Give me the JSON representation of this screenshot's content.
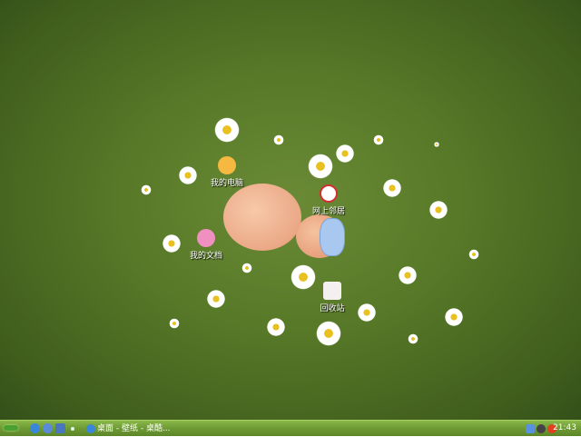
{
  "desktop": {
    "icons": [
      {
        "label": "我的电脑",
        "icon": "my-computer-icon"
      },
      {
        "label": "网上邻居",
        "icon": "network-places-icon"
      },
      {
        "label": "我的文档",
        "icon": "my-documents-icon"
      },
      {
        "label": "回收站",
        "icon": "recycle-bin-icon"
      }
    ]
  },
  "taskbar": {
    "quick_launch": [
      "show-desktop-icon",
      "ie-icon",
      "media-icon",
      "outlook-icon"
    ],
    "task_label": "桌面 - 壁纸 - 桌酷...",
    "clock": "21:43",
    "accent": "#6e9a34"
  }
}
